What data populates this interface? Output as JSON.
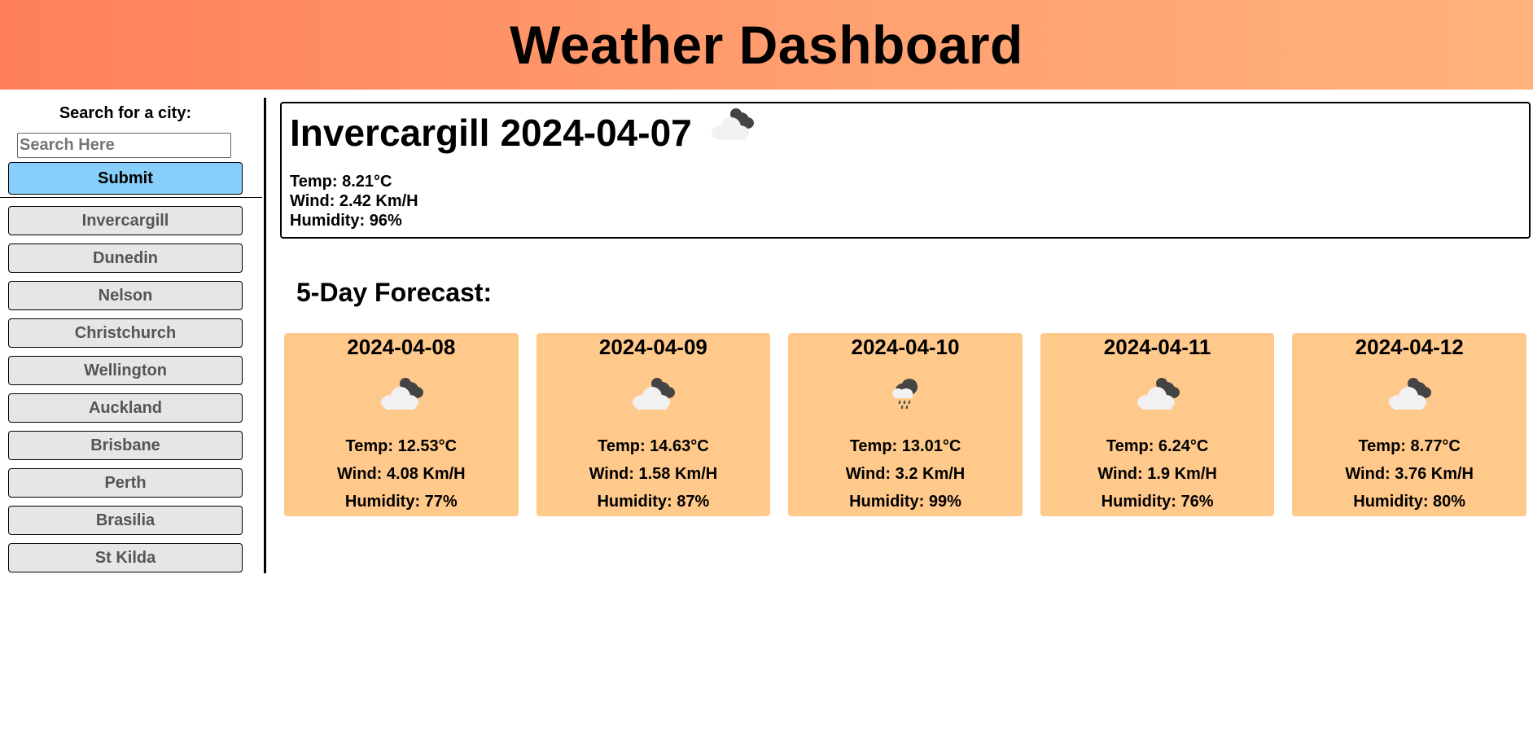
{
  "header": {
    "title": "Weather Dashboard"
  },
  "sidebar": {
    "search_label": "Search for a city:",
    "search_placeholder": "Search Here",
    "search_value": "",
    "submit_label": "Submit",
    "cities": [
      "Invercargill",
      "Dunedin",
      "Nelson",
      "Christchurch",
      "Wellington",
      "Auckland",
      "Brisbane",
      "Perth",
      "Brasilia",
      "St Kilda"
    ]
  },
  "current": {
    "city": "Invercargill",
    "date": "2024-04-07",
    "icon": "cloudy-icon",
    "temp": "Temp: 8.21°C",
    "wind": "Wind: 2.42 Km/H",
    "humidity": "Humidity: 96%"
  },
  "forecast": {
    "heading": "5-Day Forecast:",
    "days": [
      {
        "date": "2024-04-08",
        "icon": "cloudy-icon",
        "temp": "Temp: 12.53°C",
        "wind": "Wind: 4.08 Km/H",
        "humidity": "Humidity: 77%"
      },
      {
        "date": "2024-04-09",
        "icon": "cloudy-icon",
        "temp": "Temp: 14.63°C",
        "wind": "Wind: 1.58 Km/H",
        "humidity": "Humidity: 87%"
      },
      {
        "date": "2024-04-10",
        "icon": "light-rain-icon",
        "temp": "Temp: 13.01°C",
        "wind": "Wind: 3.2 Km/H",
        "humidity": "Humidity: 99%"
      },
      {
        "date": "2024-04-11",
        "icon": "cloudy-icon",
        "temp": "Temp: 6.24°C",
        "wind": "Wind: 1.9 Km/H",
        "humidity": "Humidity: 76%"
      },
      {
        "date": "2024-04-12",
        "icon": "cloudy-icon",
        "temp": "Temp: 8.77°C",
        "wind": "Wind: 3.76 Km/H",
        "humidity": "Humidity: 80%"
      }
    ]
  },
  "colors": {
    "header_gradient_start": "#ff7f5c",
    "header_gradient_end": "#ffb27c",
    "submit_bg": "#87cefa",
    "city_button_bg": "#e6e6e6",
    "forecast_card_bg": "#ffc98b"
  }
}
